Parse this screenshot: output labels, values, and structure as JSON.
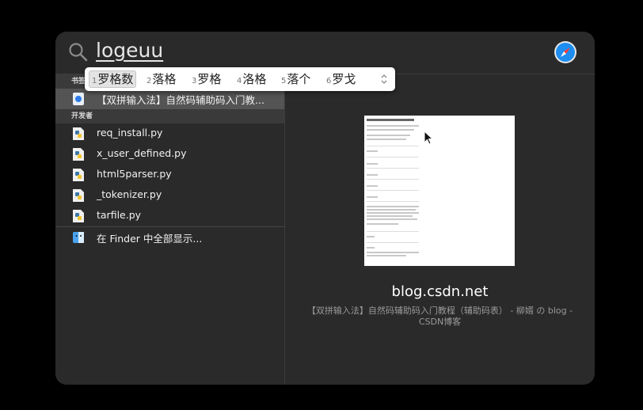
{
  "search": {
    "query": "logeuu"
  },
  "sections": {
    "bookmarks_header": "书签",
    "developer_header": "开发者"
  },
  "results": {
    "bookmark": "【双拼输入法】自然码辅助码入门教...",
    "files": [
      "req_install.py",
      "x_user_defined.py",
      "html5parser.py",
      "_tokenizer.py",
      "tarfile.py"
    ],
    "show_all": "在 Finder 中全部显示..."
  },
  "preview": {
    "host": "blog.csdn.net",
    "title_line1": "【双拼输入法】自然码辅助码入门教程（辅助码表） - 柳婿 の blog -",
    "title_line2": "CSDN博客"
  },
  "ime": {
    "candidates": [
      {
        "num": "1",
        "text": "罗格数"
      },
      {
        "num": "2",
        "text": "落格"
      },
      {
        "num": "3",
        "text": "罗格"
      },
      {
        "num": "4",
        "text": "洛格"
      },
      {
        "num": "5",
        "text": "落个"
      },
      {
        "num": "6",
        "text": "罗戈"
      }
    ]
  },
  "icons": {
    "search": "search-icon",
    "safari": "safari-icon",
    "python_file": "python-file-icon",
    "finder": "finder-icon",
    "bookmark": "bookmark-icon"
  },
  "colors": {
    "panel_bg": "#2a2a2a",
    "selected_row": "#545454",
    "section_header": "#3a3a3a"
  }
}
